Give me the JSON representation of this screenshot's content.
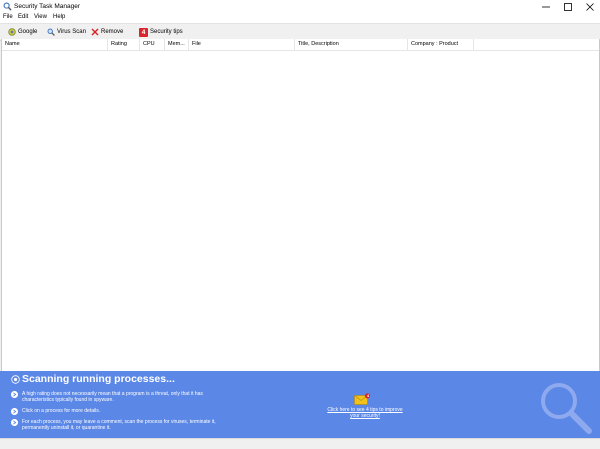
{
  "window": {
    "title": "Security Task Manager",
    "icon": "magnifier-icon",
    "controls": {
      "minimize": "minimize-icon",
      "maximize": "maximize-icon",
      "close": "close-icon"
    }
  },
  "menu": [
    "File",
    "Edit",
    "View",
    "Help"
  ],
  "toolbar": {
    "google_label": "Google",
    "virus_scan_label": "Virus Scan",
    "remove_label": "Remove",
    "tips_badge": "4",
    "security_tips_label": "Security tips"
  },
  "columns": [
    "Name",
    "Rating",
    "CPU",
    "Mem...",
    "File",
    "Title, Description",
    "Company : Product"
  ],
  "panel": {
    "heading": "Scanning running processes...",
    "tips": [
      "A high rating does not necessarily mean that a program is a threat, only that it has characteristics typically found in spyware.",
      "Click on a process for more details.",
      "For each process, you may leave a comment, scan the process for viruses, terminate it, permanently uninstall it, or quarantine it."
    ],
    "envelope_badge": "4",
    "tips_link": "Click here to see 4 tips to improve your security!"
  },
  "colors": {
    "panel_bg": "#5b87e6",
    "badge_red": "#d9262c",
    "remove_red": "#d62222",
    "envelope_yellow": "#f3c21a"
  }
}
